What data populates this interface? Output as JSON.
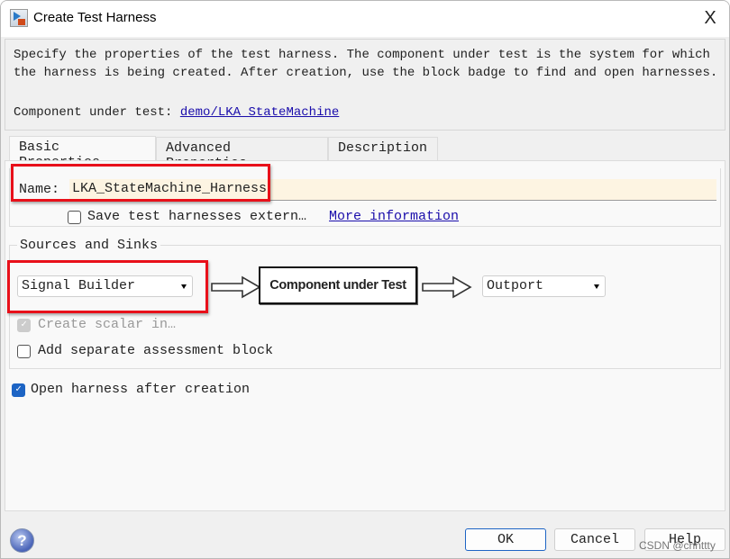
{
  "window": {
    "title": "Create Test Harness",
    "close_label": "X"
  },
  "description": {
    "text": "Specify the properties of the test harness. The component under test is the system for which the harness is being created. After creation, use the block badge to find and open harnesses.",
    "component_label": "Component under test:",
    "component_link": "demo/LKA_StateMachine"
  },
  "tabs": [
    {
      "label": "Basic Properties",
      "active": true
    },
    {
      "label": "Advanced Properties"
    },
    {
      "label": "Description"
    }
  ],
  "basic": {
    "name_label": "Name:",
    "name_value": "LKA_StateMachine_Harness",
    "save_external_label": "Save test harnesses extern…",
    "save_external_checked": false,
    "more_info_link": "More information"
  },
  "sources": {
    "title": "Sources and Sinks",
    "source_value": "Signal Builder",
    "component_box": "Component under Test",
    "sink_value": "Outport",
    "create_scalar_label": "Create scalar in…",
    "create_scalar_checked": true,
    "create_scalar_disabled": true,
    "assessment_label": "Add separate assessment block",
    "assessment_checked": false
  },
  "open_after": {
    "label": "Open harness after creation",
    "checked": true
  },
  "buttons": {
    "ok": "OK",
    "cancel": "Cancel",
    "help": "Help"
  },
  "help_icon": "?",
  "watermark": "CSDN @chnttty",
  "colors": {
    "highlight": "#e8101a",
    "accent": "#1d64c4",
    "link": "#1a0dab"
  }
}
